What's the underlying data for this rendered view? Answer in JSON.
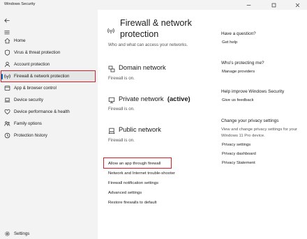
{
  "window": {
    "title": "Windows Security",
    "controls": [
      "minimize-icon",
      "maximize-icon",
      "close-icon"
    ]
  },
  "sidebar": {
    "items": [
      {
        "label": "Home",
        "icon": "home-icon"
      },
      {
        "label": "Virus & threat protection",
        "icon": "shield-icon"
      },
      {
        "label": "Account protection",
        "icon": "person-icon"
      },
      {
        "label": "Firewall & network protection",
        "icon": "antenna-icon",
        "selected": true
      },
      {
        "label": "App & browser control",
        "icon": "app-window-icon"
      },
      {
        "label": "Device security",
        "icon": "laptop-icon"
      },
      {
        "label": "Device performance & health",
        "icon": "heart-icon"
      },
      {
        "label": "Family options",
        "icon": "family-icon"
      },
      {
        "label": "Protection history",
        "icon": "history-icon"
      }
    ],
    "settings_label": "Settings"
  },
  "main": {
    "title": "Firewall & network protection",
    "subtitle": "Who and what can access your networks.",
    "networks": [
      {
        "name": "Domain network",
        "active_label": "",
        "status": "Firewall is on."
      },
      {
        "name": "Private network",
        "active_label": "(active)",
        "status": "Firewall is on."
      },
      {
        "name": "Public network",
        "active_label": "",
        "status": "Firewall is on."
      }
    ],
    "links": [
      "Allow an app through firewall",
      "Network and Internet trouble-shooter",
      "Firewall notification settings",
      "Advanced settings",
      "Restore firewalls to default"
    ]
  },
  "side": {
    "question_heading": "Have a question?",
    "question_link": "Get help",
    "protecting_heading": "Who's protecting me?",
    "protecting_link": "Manage providers",
    "improve_heading": "Help improve Windows Security",
    "improve_link": "Give us feedback",
    "privacy_heading": "Change your privacy settings",
    "privacy_text": "View and change privacy settings for your Windows 11 Pro device.",
    "privacy_links": [
      "Privacy settings",
      "Privacy dashboard",
      "Privacy Statement"
    ]
  },
  "colors": {
    "accent": "#0067c0",
    "highlight_box": "#d21f2a",
    "sidebar_bg": "#f3f3f3"
  }
}
